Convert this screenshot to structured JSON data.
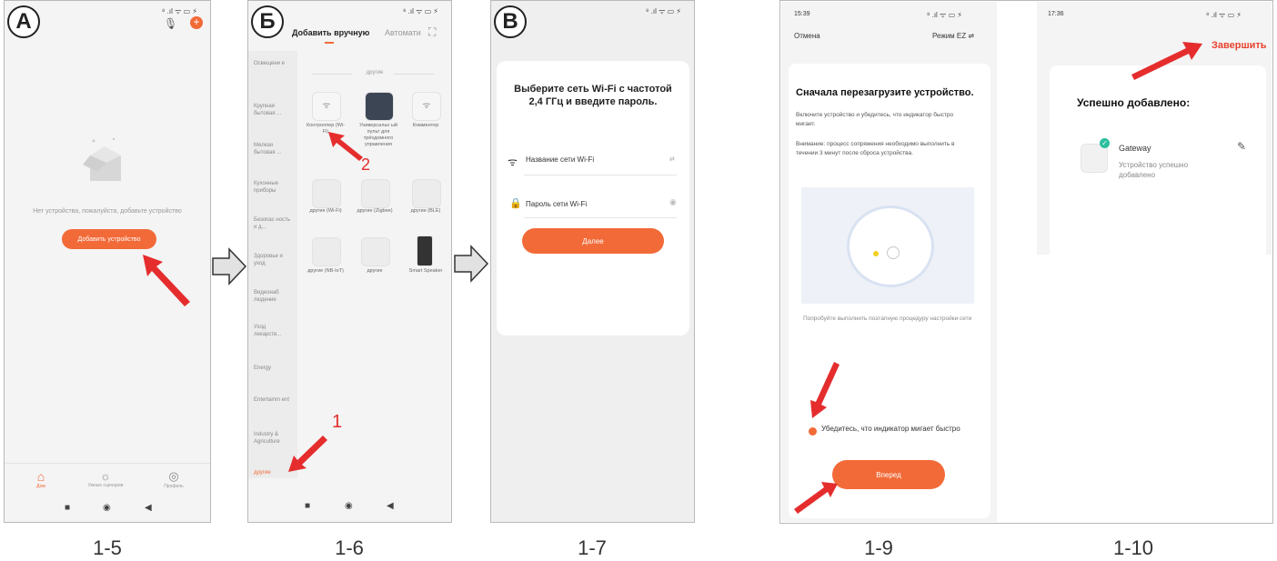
{
  "screens": {
    "a": {
      "badge": "А",
      "caption": "1-5",
      "status": "⁸ .ıl ᯤ ▭ ⚡",
      "empty_text": "Нет устройства, пожалуйста, добавьте устройство",
      "add_button": "Добавить устройство",
      "tabs": [
        "Дом",
        "Умные сценарии",
        "Профиль"
      ]
    },
    "b": {
      "badge": "Б",
      "caption": "1-6",
      "status": "⁸ .ıl ᯤ ▭ ⚡",
      "tab_manual": "Добавить вручную",
      "tab_auto": "Автомати",
      "section_title": "другие",
      "sidebar": [
        "Освещени е",
        "Крупная бытовая ...",
        "Мелкая бытовая ...",
        "Кухонные приборы",
        "Безопас ность и д...",
        "Здоровье и уход",
        "Видеонаб людение",
        "Уход лекарств...",
        "Energy",
        "Entertainm ent",
        "Industry & Agriculture",
        "другие"
      ],
      "devices": [
        "Контроллер (Wi-Fi)",
        "Универсальн ый пульт для трёхдомного управления",
        "Комментер",
        "другие (Wi-Fi)",
        "другие (Zigbee)",
        "другие (BLE)",
        "другие (NB-IoT)",
        "другие",
        "Smart Speaker"
      ],
      "mark_1": "1",
      "mark_2": "2"
    },
    "c": {
      "badge": "В",
      "caption": "1-7",
      "status": "⁸ .ıl ᯤ ▭ ⚡",
      "heading": "Выберите сеть Wi-Fi с частотой 2,4 ГГц и введите пароль.",
      "ssid_placeholder": "Название сети Wi-Fi",
      "password_placeholder": "Пароль сети Wi-Fi",
      "next_button": "Далее"
    },
    "d": {
      "caption": "1-9",
      "time": "15:39",
      "status": "⁸ .ıl ᯤ ▭ ⚡",
      "cancel": "Отмена",
      "mode": "Режим EZ ⇌",
      "heading": "Сначала перезагрузите устройство.",
      "text1": "Включите устройство и убедитесь, что индикатор быстро мигает.",
      "text2": "Внимание: процесс сопряжения необходимо выполнить в течении 3 минут после сброса устройства.",
      "help_link": "Попробуйте выполнить поэтапную процедуру настройки сети",
      "confirm_text": "Убедитесь, что индикатор мигает быстро",
      "forward_button": "Вперед"
    },
    "e": {
      "caption": "1-10",
      "time": "17:36",
      "status": "⁸ .ıl ᯤ ▭ ⚡",
      "finish": "Завершить",
      "heading": "Успешно добавлено:",
      "device_name": "Gateway",
      "device_status": "Устройство успешно добавлено"
    }
  },
  "colors": {
    "accent": "#f26a38",
    "arrow": "#e52d2d",
    "check": "#2bbf9e"
  }
}
